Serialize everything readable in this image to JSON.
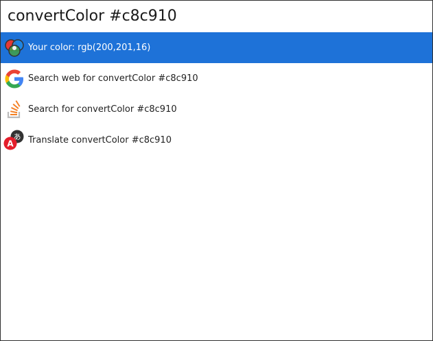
{
  "search": {
    "query": "convertColor #c8c910"
  },
  "results": [
    {
      "label": "Your color: rgb(200,201,16)",
      "icon": "color-wheel-icon",
      "selected": true
    },
    {
      "label": "Search web for convertColor #c8c910",
      "icon": "google-icon",
      "selected": false
    },
    {
      "label": "Search for convertColor #c8c910",
      "icon": "stackoverflow-icon",
      "selected": false
    },
    {
      "label": "Translate convertColor #c8c910",
      "icon": "translate-icon",
      "selected": false
    }
  ],
  "colors": {
    "selection": "#1e72d8",
    "sampled_color": "#c8c910"
  }
}
